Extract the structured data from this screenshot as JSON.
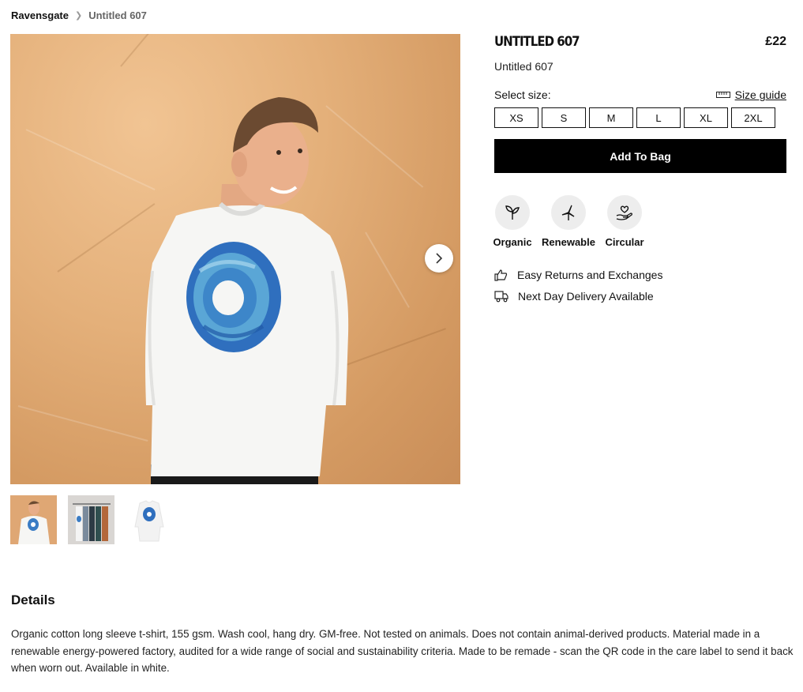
{
  "breadcrumb": {
    "home": "Ravensgate",
    "current": "Untitled 607"
  },
  "product": {
    "title": "UNTITLED 607",
    "price": "£22",
    "subtitle": "Untitled 607",
    "select_size_label": "Select size:",
    "size_guide_label": "Size guide",
    "sizes": [
      "XS",
      "S",
      "M",
      "L",
      "XL",
      "2XL"
    ],
    "add_to_bag": "Add To Bag",
    "badges": [
      {
        "label": "Organic",
        "icon": "sprout-icon"
      },
      {
        "label": "Renewable",
        "icon": "wind-turbine-icon"
      },
      {
        "label": "Circular",
        "icon": "heart-hand-icon"
      }
    ],
    "features": [
      {
        "label": "Easy Returns and Exchanges",
        "icon": "thumbs-up-icon"
      },
      {
        "label": "Next Day Delivery Available",
        "icon": "delivery-truck-icon"
      }
    ]
  },
  "gallery": {
    "thumbnail_count": 3,
    "selected_index": 0
  },
  "details": {
    "heading": "Details",
    "text": "Organic cotton long sleeve t-shirt, 155 gsm. Wash cool, hang dry. GM-free. Not tested on animals. Does not contain animal-derived products. Material made in a renewable energy-powered factory, audited for a wide range of social and sustainability criteria. Made to be remade - scan the QR code in the care label to send it back when worn out. Available in white."
  },
  "colors": {
    "accent": "#000000",
    "badge_bg": "#ededed",
    "backdrop": "#e4b07a",
    "print_blue": "#3a78c8"
  }
}
